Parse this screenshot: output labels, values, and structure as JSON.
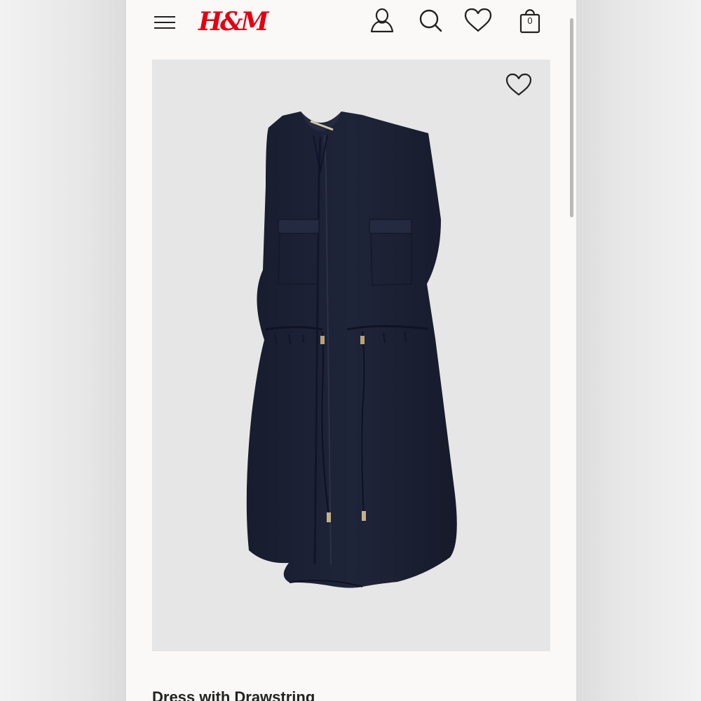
{
  "header": {
    "logo_text": "H&M",
    "menu_icon": "hamburger-menu-icon",
    "account_icon": "user-account-icon",
    "search_icon": "search-icon",
    "favorites_icon": "heart-icon",
    "bag_icon": "shopping-bag-icon",
    "bag_count": "0"
  },
  "product": {
    "title": "Dress with Drawstring",
    "image_description_icon": "product-image",
    "favorite_icon": "heart-icon",
    "dress_color": "#1c2135"
  },
  "colors": {
    "brand_red": "#e50010",
    "page_background": "#faf9f8",
    "image_background": "#e6e6e6"
  }
}
